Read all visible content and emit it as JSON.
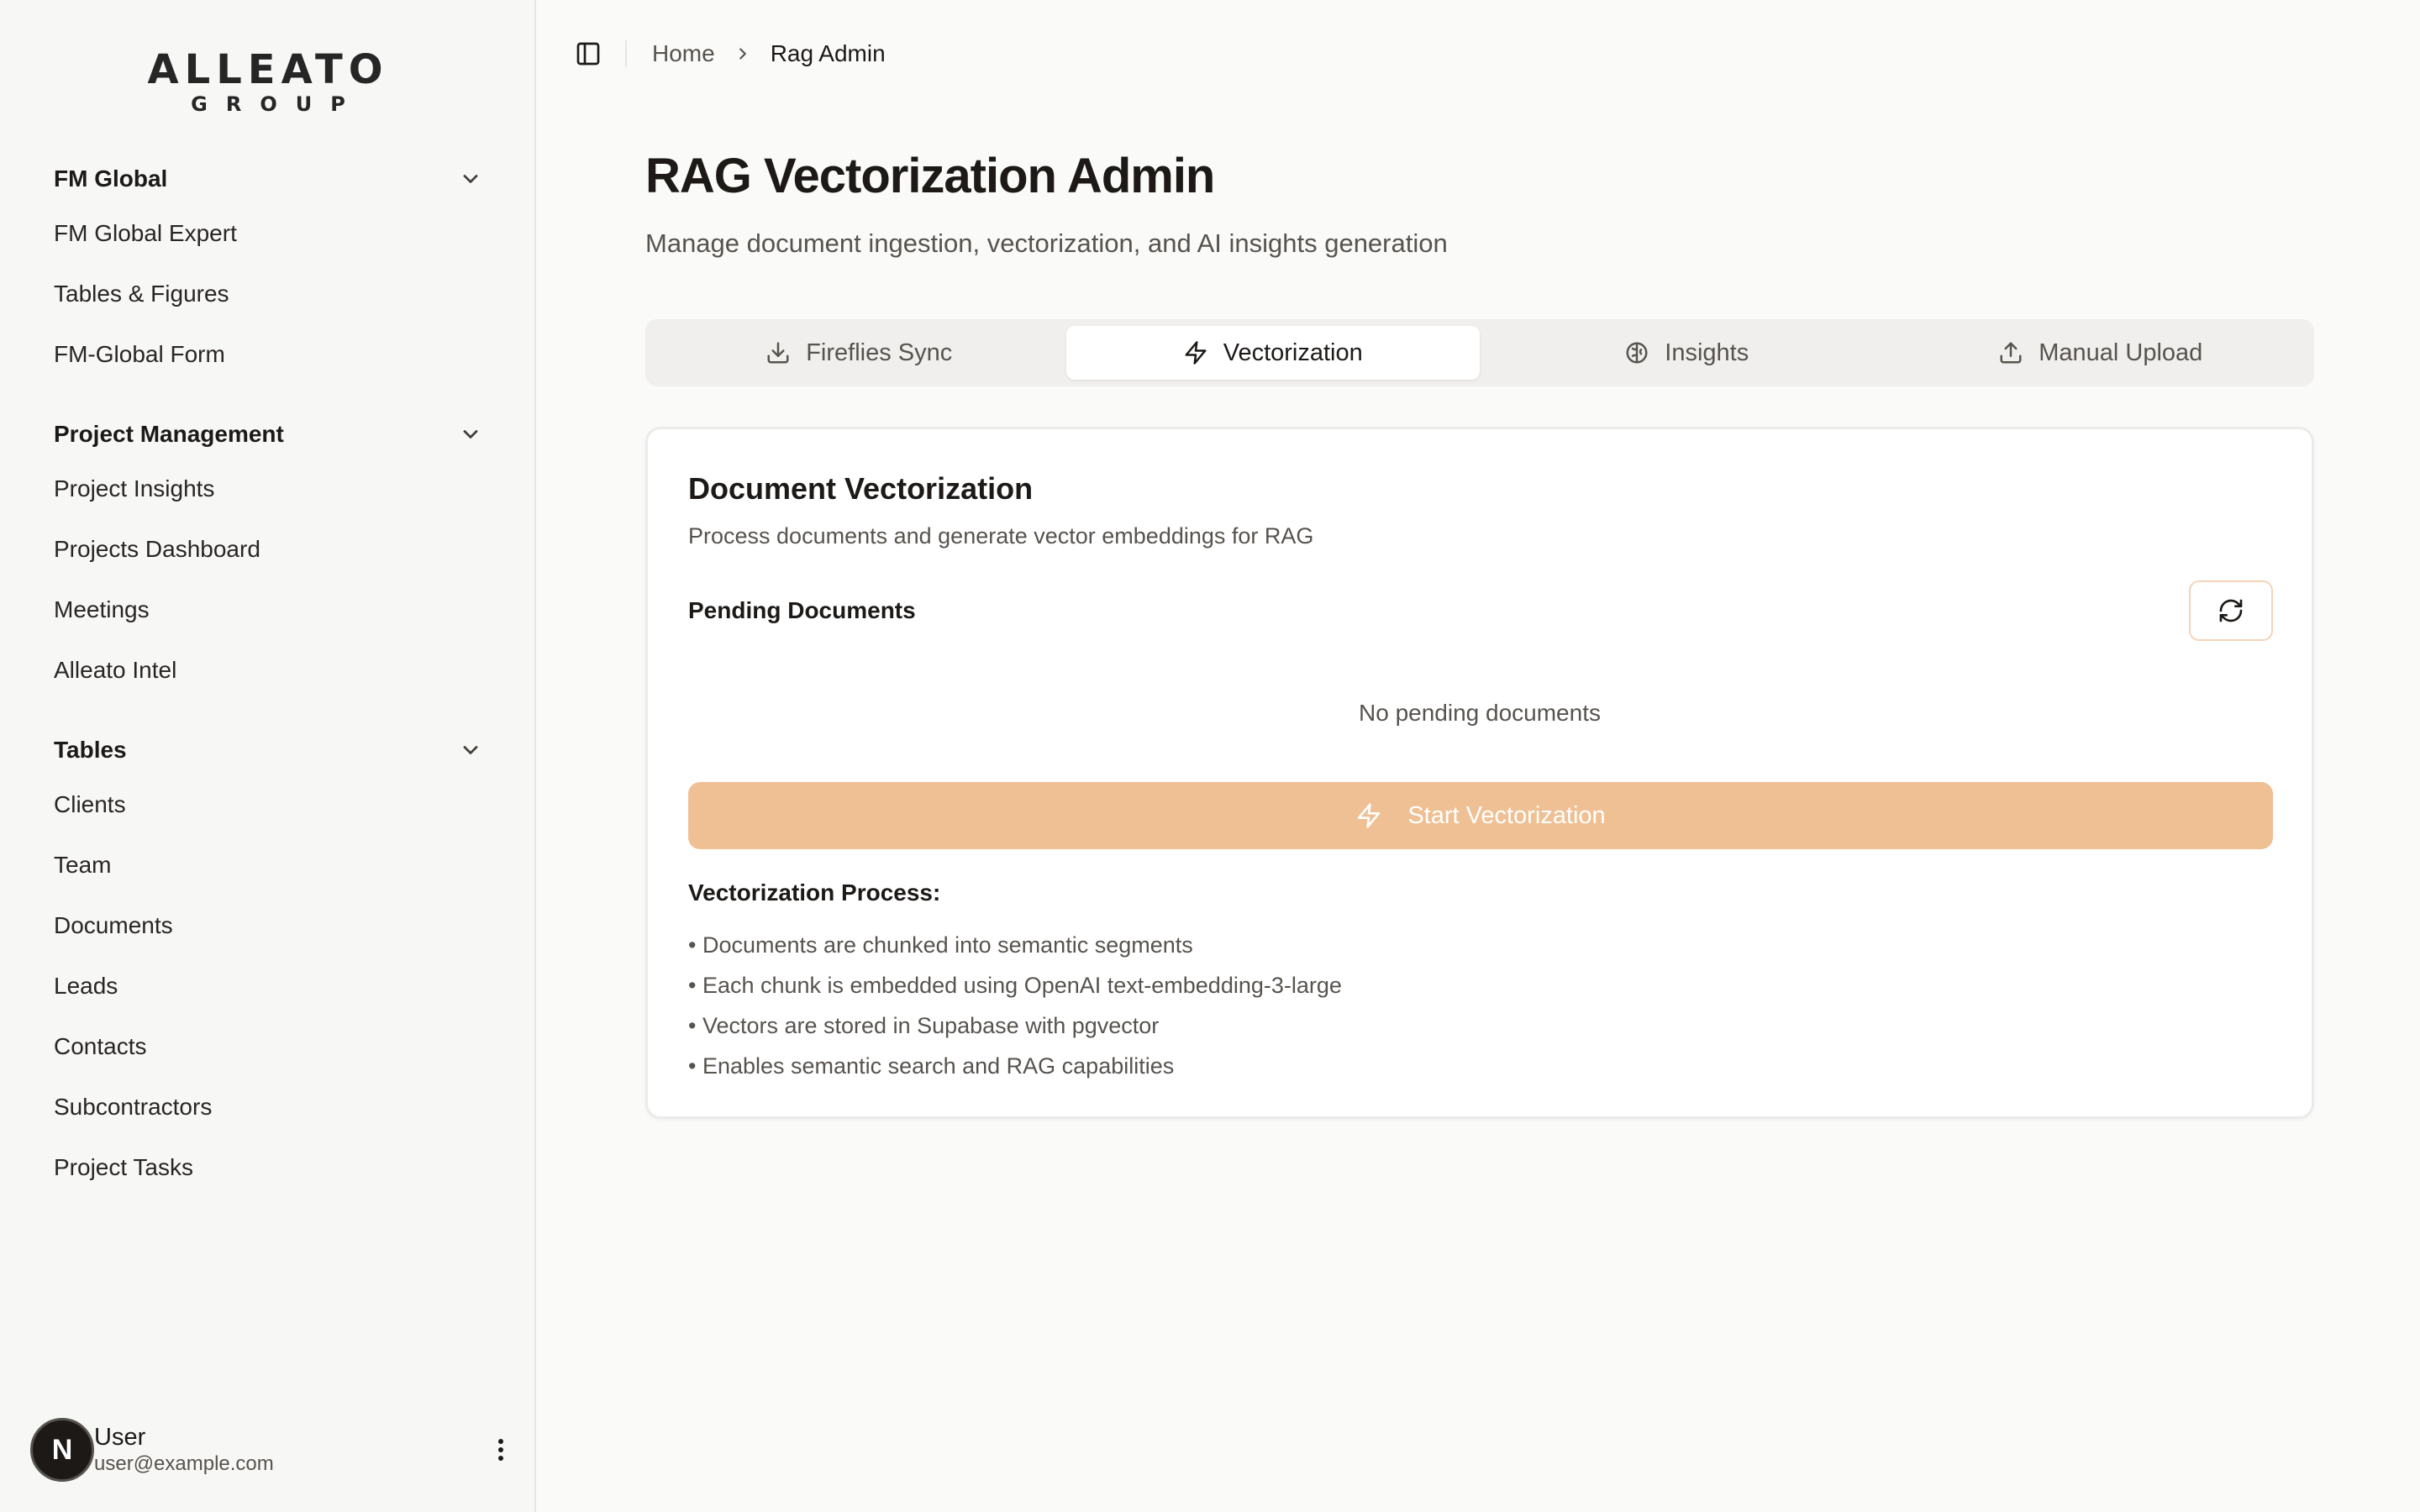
{
  "brand": {
    "logo_main": "ALLEATO",
    "logo_sub": "GROUP",
    "accent_color": "#e0822a"
  },
  "sidebar": {
    "groups": [
      {
        "title": "FM Global",
        "items": [
          "FM Global Expert",
          "Tables & Figures",
          "FM-Global Form"
        ]
      },
      {
        "title": "Project Management",
        "items": [
          "Project Insights",
          "Projects Dashboard",
          "Meetings",
          "Alleato Intel"
        ]
      },
      {
        "title": "Tables",
        "items": [
          "Clients",
          "Team",
          "Documents",
          "Leads",
          "Contacts",
          "Subcontractors",
          "Project Tasks"
        ]
      }
    ],
    "user": {
      "avatar_letter": "N",
      "name": "User",
      "email": "user@example.com"
    }
  },
  "breadcrumb": {
    "home": "Home",
    "current": "Rag Admin"
  },
  "page": {
    "title": "RAG Vectorization Admin",
    "subtitle": "Manage document ingestion, vectorization, and AI insights generation"
  },
  "tabs": [
    {
      "label": "Fireflies Sync",
      "icon": "download-icon",
      "active": false
    },
    {
      "label": "Vectorization",
      "icon": "zap-icon",
      "active": true
    },
    {
      "label": "Insights",
      "icon": "brain-icon",
      "active": false
    },
    {
      "label": "Manual Upload",
      "icon": "upload-icon",
      "active": false
    }
  ],
  "card": {
    "title": "Document Vectorization",
    "description": "Process documents and generate vector embeddings for RAG",
    "pending_label": "Pending Documents",
    "empty_message": "No pending documents",
    "start_button": "Start Vectorization",
    "process_title": "Vectorization Process:",
    "process_steps": [
      "• Documents are chunked into semantic segments",
      "• Each chunk is embedded using OpenAI text-embedding-3-large",
      "• Vectors are stored in Supabase with pgvector",
      "• Enables semantic search and RAG capabilities"
    ],
    "button_color": "#efc093"
  }
}
